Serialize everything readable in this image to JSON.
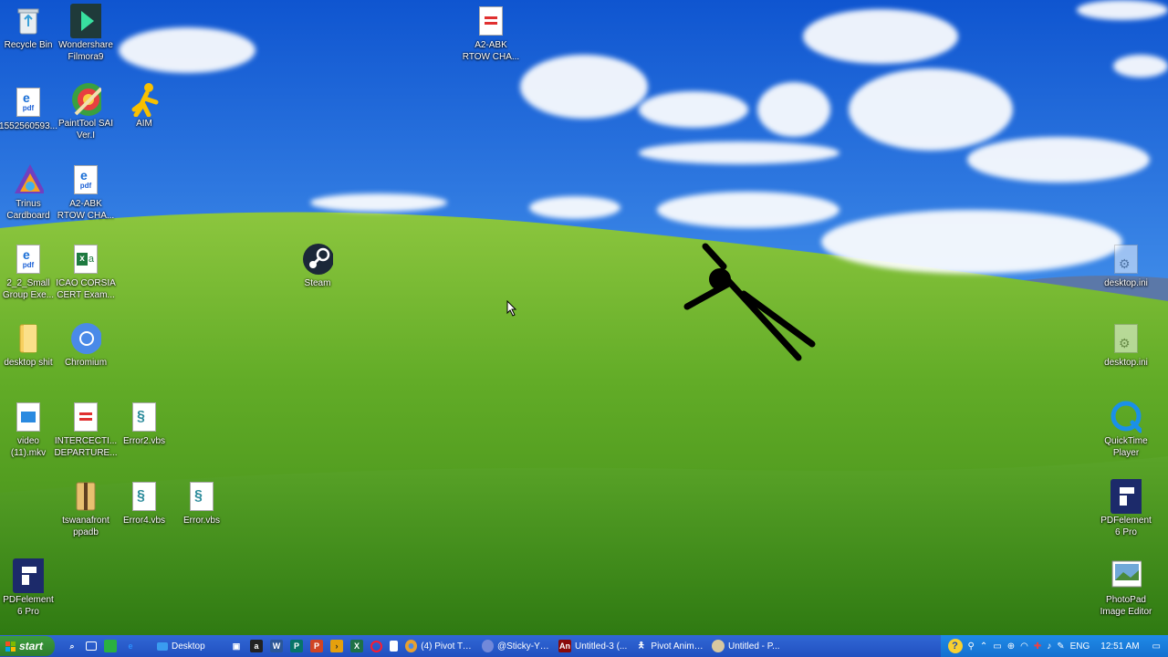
{
  "desktop": {
    "icons": [
      {
        "label": "Recycle Bin",
        "icon": "recycle-bin-icon"
      },
      {
        "label": "Wondershare\nFilmora9",
        "icon": "filmora-icon"
      },
      {
        "label": "1552560593...",
        "icon": "pdf-file-icon"
      },
      {
        "label": "PaintTool SAI\nVer.I",
        "icon": "painttool-sai-icon"
      },
      {
        "label": "AIM",
        "icon": "aim-icon"
      },
      {
        "label": "Trinus\nCardboard",
        "icon": "trinus-icon"
      },
      {
        "label": "A2-ABK\nRTOW CHA...",
        "icon": "pdf-file-icon"
      },
      {
        "label": "2_2_Small\nGroup Exe...",
        "icon": "pdf-file-icon"
      },
      {
        "label": "ICAO CORSIA\nCERT Exam...",
        "icon": "excel-file-icon"
      },
      {
        "label": "desktop shit",
        "icon": "folder-icon"
      },
      {
        "label": "Chromium",
        "icon": "chromium-icon"
      },
      {
        "label": "video\n(11).mkv",
        "icon": "video-file-icon"
      },
      {
        "label": "INTERCECTI...\nDEPARTURE...",
        "icon": "document-file-icon"
      },
      {
        "label": "Error2.vbs",
        "icon": "vbs-script-icon"
      },
      {
        "label": "tswanafront\nppadb",
        "icon": "archive-icon"
      },
      {
        "label": "Error4.vbs",
        "icon": "vbs-script-icon"
      },
      {
        "label": "Error.vbs",
        "icon": "vbs-script-icon"
      },
      {
        "label": "PDFelement\n6 Pro",
        "icon": "pdfelement-icon"
      },
      {
        "label": "A2-ABK\nRTOW CHA...",
        "icon": "document-file-icon"
      },
      {
        "label": "Steam",
        "icon": "steam-icon"
      },
      {
        "label": "desktop.ini",
        "icon": "settings-file-icon"
      },
      {
        "label": "desktop.ini",
        "icon": "settings-file-icon"
      },
      {
        "label": "QuickTime\nPlayer",
        "icon": "quicktime-icon"
      },
      {
        "label": "PDFelement\n6 Pro",
        "icon": "pdfelement-icon"
      },
      {
        "label": "PhotoPad\nImage Editor",
        "icon": "photopad-icon"
      }
    ]
  },
  "taskbar": {
    "start_label": "start",
    "desktop_label": "Desktop",
    "tasks": [
      {
        "label": "(4) Pivot Tut...",
        "icon": "chrome-icon"
      },
      {
        "label": "@Sticky-YT ...",
        "icon": "discord-icon"
      },
      {
        "label": "Untitled-3 (...",
        "icon": "animate-icon"
      },
      {
        "label": "Pivot Anima...",
        "icon": "pivot-icon"
      },
      {
        "label": "Untitled - P...",
        "icon": "paint-icon"
      }
    ],
    "tray": {
      "language": "ENG",
      "time": "12:51 AM"
    }
  }
}
